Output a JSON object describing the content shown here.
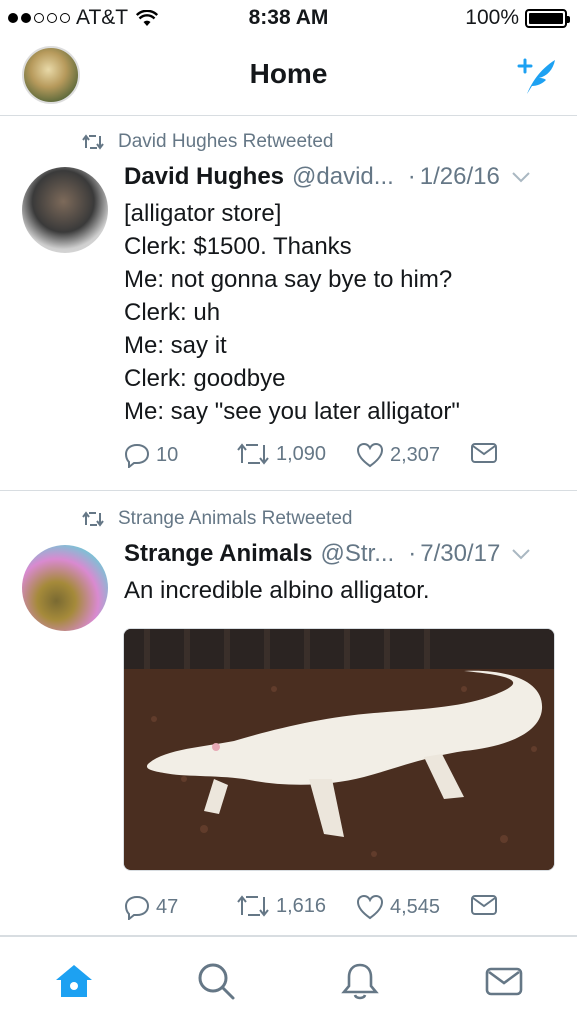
{
  "status_bar": {
    "carrier": "AT&T",
    "time": "8:38 AM",
    "battery": "100%",
    "signal_bars_filled": 2,
    "signal_bars_total": 5
  },
  "nav": {
    "title": "Home",
    "compose_icon": "compose-tweet-icon"
  },
  "colors": {
    "accent": "#1da1f2",
    "secondary_text": "#657786",
    "border": "#d8dde1"
  },
  "tweets": [
    {
      "retweeted_by": "David Hughes Retweeted",
      "name": "David Hughes",
      "handle": "@david...",
      "date": "1/26/16",
      "lines": [
        "[alligator store]",
        "Clerk: $1500. Thanks",
        "Me: not gonna say bye to him?",
        "Clerk: uh",
        "Me: say it",
        "Clerk: goodbye",
        "Me: say \"see you later alligator\""
      ],
      "replies": "10",
      "retweets": "1,090",
      "likes": "2,307"
    },
    {
      "retweeted_by": "Strange Animals Retweeted",
      "name": "Strange Animals",
      "handle": "@Str...",
      "date": "7/30/17",
      "lines": [
        "An incredible albino alligator."
      ],
      "has_media": true,
      "replies": "47",
      "retweets": "1,616",
      "likes": "4,545"
    }
  ],
  "tab_bar": {
    "tabs": [
      "home-icon",
      "search-icon",
      "notifications-icon",
      "messages-icon"
    ],
    "active": "home-icon"
  }
}
